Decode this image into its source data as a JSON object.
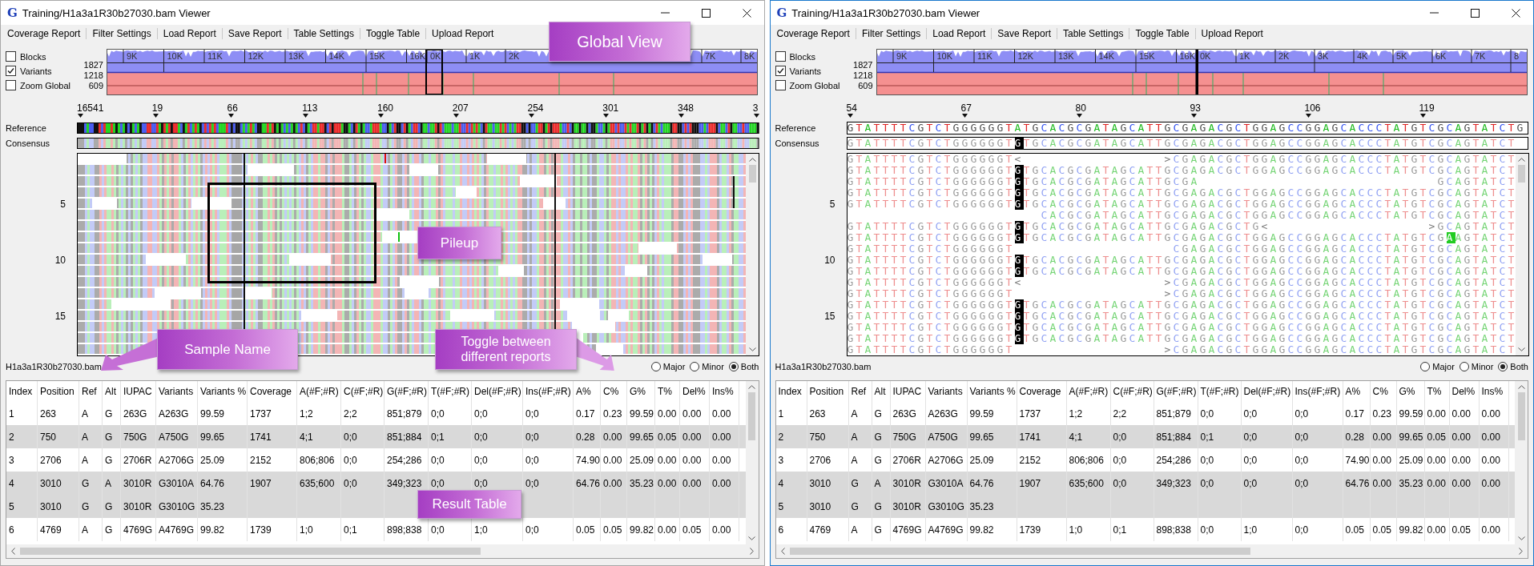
{
  "windows": [
    {
      "active": false,
      "app_icon": "G",
      "title": "Training/H1a3a1R30b27030.bam Viewer",
      "menu": [
        "Coverage Report",
        "Filter Settings",
        "Load Report",
        "Save Report",
        "Table Settings",
        "Toggle Table",
        "Upload Report"
      ],
      "options": [
        {
          "label": "Blocks",
          "checked": false
        },
        {
          "label": "Variants",
          "checked": true
        },
        {
          "label": "Zoom Global",
          "checked": false
        }
      ],
      "axis_labels": [
        "1827",
        "1218",
        "609"
      ],
      "tick_labels": [
        "9K",
        "10K",
        "11K",
        "12K",
        "13K",
        "14K",
        "15K",
        "16K",
        "0K",
        "1K",
        "2K"
      ],
      "tick_labels_right": [
        "7K",
        "8K"
      ],
      "ruler": [
        "16541",
        "19",
        "66",
        "113",
        "160",
        "207",
        "254",
        "301",
        "348",
        "3"
      ],
      "reference_label": "Reference",
      "consensus_label": "Consensus",
      "pileup": {
        "kind": "bars",
        "row_numbers": [
          "5",
          "10",
          "15"
        ]
      },
      "sample_name": "H1a3a1R30b27030.bam",
      "view_modes": [
        {
          "label": "Major",
          "selected": false
        },
        {
          "label": "Minor",
          "selected": false
        },
        {
          "label": "Both",
          "selected": true
        }
      ],
      "table": {
        "columns": [
          "Index",
          "Position",
          "Ref",
          "Alt",
          "IUPAC",
          "Variants",
          "Variants %",
          "Coverage",
          "A(#F;#R)",
          "C(#F;#R)",
          "G(#F;#R)",
          "T(#F;#R)",
          "Del(#F;#R)",
          "Ins(#F;#R)",
          "A%",
          "C%",
          "G%",
          "T%",
          "Del%",
          "Ins%"
        ],
        "rows": [
          {
            "shaded": false,
            "cells": [
              "1",
              "263",
              "A",
              "G",
              "263G",
              "A263G",
              "99.59",
              "1737",
              "1;2",
              "2;2",
              "851;879",
              "0;0",
              "0;0",
              "0;0",
              "0.17",
              "0.23",
              "99.59",
              "0.00",
              "0.00",
              "0.00"
            ]
          },
          {
            "shaded": true,
            "cells": [
              "2",
              "750",
              "A",
              "G",
              "750G",
              "A750G",
              "99.65",
              "1741",
              "4;1",
              "0;0",
              "851;884",
              "0;1",
              "0;0",
              "0;0",
              "0.28",
              "0.00",
              "99.65",
              "0.05",
              "0.00",
              "0.00"
            ]
          },
          {
            "shaded": false,
            "cells": [
              "3",
              "2706",
              "A",
              "G",
              "2706R",
              "A2706G",
              "25.09",
              "2152",
              "806;806",
              "0;0",
              "254;286",
              "0;0",
              "0;0",
              "0;0",
              "74.90",
              "0.00",
              "25.09",
              "0.00",
              "0.00",
              "0.00"
            ]
          },
          {
            "shaded": true,
            "cells": [
              "4",
              "3010",
              "G",
              "A",
              "3010R",
              "G3010A",
              "64.76",
              "1907",
              "635;600",
              "0;0",
              "349;323",
              "0;0",
              "0;0",
              "0;0",
              "64.76",
              "0.00",
              "35.23",
              "0.00",
              "0.00",
              "0.00"
            ]
          },
          {
            "shaded": true,
            "cells": [
              "5",
              "3010",
              "G",
              "G",
              "3010R",
              "G3010G",
              "35.23"
            ]
          },
          {
            "shaded": false,
            "cells": [
              "6",
              "4769",
              "A",
              "G",
              "4769G",
              "A4769G",
              "99.82",
              "1739",
              "1;0",
              "0;1",
              "898;838",
              "0;0",
              "1;0",
              "0;0",
              "0.05",
              "0.05",
              "99.82",
              "0.00",
              "0.05",
              "0.00"
            ]
          }
        ]
      }
    },
    {
      "active": true,
      "app_icon": "G",
      "title": "Training/H1a3a1R30b27030.bam Viewer",
      "menu": [
        "Coverage Report",
        "Filter Settings",
        "Load Report",
        "Save Report",
        "Table Settings",
        "Toggle Table",
        "Upload Report"
      ],
      "options": [
        {
          "label": "Blocks",
          "checked": false
        },
        {
          "label": "Variants",
          "checked": true
        },
        {
          "label": "Zoom Global",
          "checked": false
        }
      ],
      "axis_labels": [
        "1827",
        "1218",
        "609"
      ],
      "tick_labels": [
        "9K",
        "10K",
        "11K",
        "12K",
        "13K",
        "14K",
        "15K",
        "16K",
        "0K",
        "1K",
        "2K",
        "3K",
        "4K",
        "5K",
        "6K",
        "7K",
        "8"
      ],
      "ruler": [
        "54",
        "67",
        "80",
        "93",
        "106",
        "119"
      ],
      "reference_label": "Reference",
      "consensus_label": "Consensus",
      "pileup": {
        "kind": "letters",
        "row_numbers": [
          "5",
          "10",
          "15"
        ],
        "reference": "GTATTTTCGTCTGGGGGGTATGCACGCGATAGCATTGCGAGACGCTGGAGCCGGAGCACCCTATGTCGCAGTATCTG",
        "consensus": [
          {
            "text": "GTATTTTCGTCTGGGGGGT",
            "kind": "base"
          },
          {
            "text": "G",
            "kind": "variant"
          },
          {
            "text": "TGCACGCGATAGCATTGCGAGACGCTGGAGCCGGAGCACCCTATGTCGCAGTATCT",
            "kind": "base"
          }
        ],
        "rows": [
          [
            {
              "text": "GTATTTTCGTCTGGGGGGT<                >CGAGACGCTGGAGCCGGAGCACCCTATGTCGCAGTATCT",
              "kind": "base"
            }
          ],
          [
            {
              "text": "GTATTTTCGTCTGGGGGGT",
              "kind": "base"
            },
            {
              "text": "G",
              "kind": "variant"
            },
            {
              "text": "TGCACGCGATAGCATTGCGAGACGCTGGAGCCGGAGCACCCTATGTCGCAGTATCT",
              "kind": "base"
            }
          ],
          [
            {
              "text": "GTATTTTCGTCTGGGGGGT",
              "kind": "base"
            },
            {
              "text": "G",
              "kind": "variant"
            },
            {
              "text": "TGCACGCGATAGCATTGCGA                           GCAGTATCT",
              "kind": "base"
            }
          ],
          [
            {
              "text": "GTATTTTCGTCTGGGGGGT",
              "kind": "base"
            },
            {
              "text": "G",
              "kind": "variant"
            },
            {
              "text": "TGCACGCGATAGCATTGCGAGACGCTGGAGCCGGAGCACCCTATGTCGCAGTATCT",
              "kind": "base"
            }
          ],
          [
            {
              "text": "GTATTTTCGTCTGGGGGGT",
              "kind": "base"
            },
            {
              "text": "G",
              "kind": "variant"
            },
            {
              "text": "TGCACGCGATAGCATTGCGAGACGCTGGAGCCGGAGCACCCTATGTCGCAGTATCT",
              "kind": "base"
            }
          ],
          [
            {
              "text": "                      CACGCGATAGCATTGCGAGACGCTGGAGCCGGAGCACCCTATGTCGCAGTATCT",
              "kind": "base"
            }
          ],
          [
            {
              "text": "GTATTTTCGTCTGGGGGGT",
              "kind": "base"
            },
            {
              "text": "G",
              "kind": "variant"
            },
            {
              "text": "TGCACGCGATAGCATTGCGAGACGCTG<                  >GCAGTATCT",
              "kind": "base"
            }
          ],
          [
            {
              "text": "GTATTTTCGTCTGGGGGGT",
              "kind": "base"
            },
            {
              "text": "G",
              "kind": "variant"
            },
            {
              "text": "TGCACGCGATAGCATTGCGAGACGCTGGAGCCGGAGCACCCTATGTCG",
              "kind": "base"
            },
            {
              "text": "A",
              "kind": "novel"
            },
            {
              "text": "AGTATCT",
              "kind": "base"
            }
          ],
          [
            {
              "text": "GTATTTTCGTCTGGGGGGT                  CGAGACGCTGGAGCCGGAGCACCCTATGTCGCAGTATCT",
              "kind": "base"
            }
          ],
          [
            {
              "text": "GTATTTTCGTCTGGGGGGT",
              "kind": "base"
            },
            {
              "text": "G",
              "kind": "variant"
            },
            {
              "text": "TGCACGCGATAGCATTGCGAGACGCTGGAGCCGGAGCACCCTATGTCGCAGTATCT",
              "kind": "base"
            }
          ],
          [
            {
              "text": "GTATTTTCGTCTGGGGGGT",
              "kind": "base"
            },
            {
              "text": "G",
              "kind": "variant"
            },
            {
              "text": "TGCACGCGATAGCATTGCGAGACGCTGGAGCCGGAGCACCCTATGTCGCAGTATCT",
              "kind": "base"
            }
          ],
          [
            {
              "text": "GTATTTTCGTCTGGGGGGT<                >CGAGACGCTGGAGCCGGAGCACCCTATGTCGCAGTATCT",
              "kind": "base"
            }
          ],
          [
            {
              "text": "GTATTTTCGTCTGGGGGGT                 >CGAGACGCTGGAGCCGGAGCACCCTATGTCGCAGTATCT",
              "kind": "base"
            }
          ],
          [
            {
              "text": "GTATTTTCGTCTGGGGGGT",
              "kind": "base"
            },
            {
              "text": "G",
              "kind": "variant"
            },
            {
              "text": "TGCACGCGATAGCATTGCGAGACGCTGGAGCCGGAGCACCCTATGTCGCAGTATCT",
              "kind": "base"
            }
          ],
          [
            {
              "text": "GTATTTTCGTCTGGGGGGT",
              "kind": "base"
            },
            {
              "text": "G",
              "kind": "variant"
            },
            {
              "text": "TGCACGCGATAGCATTGCGAGACGCTGGAGCCGGAGCACCCTATGTCGCAGTATCT",
              "kind": "base"
            }
          ],
          [
            {
              "text": "GTATTTTCGTCTGGGGGGT",
              "kind": "base"
            },
            {
              "text": "G",
              "kind": "variant"
            },
            {
              "text": "TGCACGCGATAGCATTGCGAGACGCTGGAGCCGGAGCACCCTATGTCGCAGTATCT",
              "kind": "base"
            }
          ],
          [
            {
              "text": "GTATTTTCGTCTGGGGGGT",
              "kind": "base"
            },
            {
              "text": "G",
              "kind": "variant"
            },
            {
              "text": "TGCACGCGATAGCATTGCGAGACGCTGGAGCCGGAGCACCCTATGTCGCAGTATCT",
              "kind": "base"
            }
          ],
          [
            {
              "text": "GTATTTTCGTCTGGGGGGT                 >CGAGACGCTGGAGCCGGAGCACCCTATGTCGCAGTATCT",
              "kind": "base"
            }
          ]
        ]
      },
      "sample_name": "H1a3a1R30b27030.bam",
      "view_modes": [
        {
          "label": "Major",
          "selected": false
        },
        {
          "label": "Minor",
          "selected": false
        },
        {
          "label": "Both",
          "selected": true
        }
      ],
      "table": {
        "columns": [
          "Index",
          "Position",
          "Ref",
          "Alt",
          "IUPAC",
          "Variants",
          "Variants %",
          "Coverage",
          "A(#F;#R)",
          "C(#F;#R)",
          "G(#F;#R)",
          "T(#F;#R)",
          "Del(#F;#R)",
          "Ins(#F;#R)",
          "A%",
          "C%",
          "G%",
          "T%",
          "Del%",
          "Ins%"
        ],
        "rows": [
          {
            "shaded": false,
            "cells": [
              "1",
              "263",
              "A",
              "G",
              "263G",
              "A263G",
              "99.59",
              "1737",
              "1;2",
              "2;2",
              "851;879",
              "0;0",
              "0;0",
              "0;0",
              "0.17",
              "0.23",
              "99.59",
              "0.00",
              "0.00",
              "0.00"
            ]
          },
          {
            "shaded": true,
            "cells": [
              "2",
              "750",
              "A",
              "G",
              "750G",
              "A750G",
              "99.65",
              "1741",
              "4;1",
              "0;0",
              "851;884",
              "0;1",
              "0;0",
              "0;0",
              "0.28",
              "0.00",
              "99.65",
              "0.05",
              "0.00",
              "0.00"
            ]
          },
          {
            "shaded": false,
            "cells": [
              "3",
              "2706",
              "A",
              "G",
              "2706R",
              "A2706G",
              "25.09",
              "2152",
              "806;806",
              "0;0",
              "254;286",
              "0;0",
              "0;0",
              "0;0",
              "74.90",
              "0.00",
              "25.09",
              "0.00",
              "0.00",
              "0.00"
            ]
          },
          {
            "shaded": true,
            "cells": [
              "4",
              "3010",
              "G",
              "A",
              "3010R",
              "G3010A",
              "64.76",
              "1907",
              "635;600",
              "0;0",
              "349;323",
              "0;0",
              "0;0",
              "0;0",
              "64.76",
              "0.00",
              "35.23",
              "0.00",
              "0.00",
              "0.00"
            ]
          },
          {
            "shaded": true,
            "cells": [
              "5",
              "3010",
              "G",
              "G",
              "3010R",
              "G3010G",
              "35.23"
            ]
          },
          {
            "shaded": false,
            "cells": [
              "6",
              "4769",
              "A",
              "G",
              "4769G",
              "A4769G",
              "99.82",
              "1739",
              "1;0",
              "0;1",
              "898;838",
              "0;0",
              "1;0",
              "0;0",
              "0.05",
              "0.05",
              "99.82",
              "0.00",
              "0.05",
              "0.00"
            ]
          }
        ]
      }
    }
  ],
  "callouts": [
    {
      "text": "Global View",
      "kind": "plain"
    },
    {
      "text": "Pileup",
      "kind": "plain"
    },
    {
      "text": "Sample Name",
      "kind": "arrow-left"
    },
    {
      "text": "Toggle between different reports",
      "kind": "arrow-right"
    },
    {
      "text": "Result Table",
      "kind": "plain"
    }
  ]
}
